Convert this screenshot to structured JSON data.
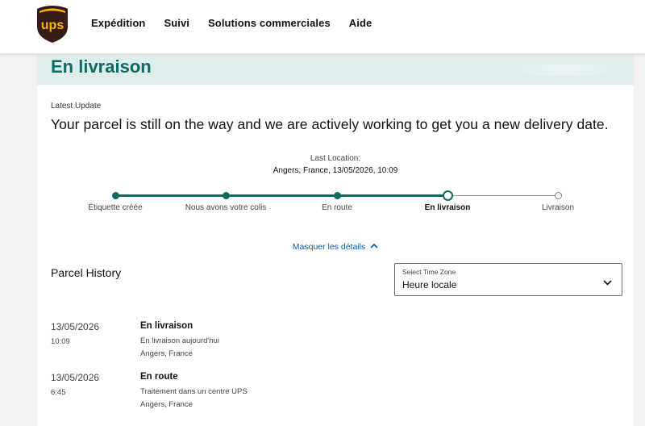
{
  "header": {
    "logo_text": "ups",
    "nav": [
      "Expédition",
      "Suivi",
      "Solutions commerciales",
      "Aide"
    ]
  },
  "status": {
    "title": "En livraison"
  },
  "latest_update": {
    "label": "Latest Update",
    "message": "Your parcel is still on the way and we are actively working to get you a new delivery date."
  },
  "last_location": {
    "label": "Last Location:",
    "value": "Angers, France, 13/05/2026, 10:09"
  },
  "progress": {
    "steps": [
      {
        "label": "Étiquette créée",
        "state": "done"
      },
      {
        "label": "Nous avons votre colis",
        "state": "done"
      },
      {
        "label": "En route",
        "state": "done"
      },
      {
        "label": "En livraison",
        "state": "current"
      },
      {
        "label": "Livraison",
        "state": "future"
      }
    ]
  },
  "details_toggle": "Masquer les détails",
  "history": {
    "title": "Parcel History",
    "timezone": {
      "label": "Select Time Zone",
      "value": "Heure locale"
    },
    "events": [
      {
        "date": "13/05/2026",
        "time": "10:09",
        "status": "En livraison",
        "description": "En livraison aujourd'hui",
        "location": "Angers, France"
      },
      {
        "date": "13/05/2026",
        "time": "6:45",
        "status": "En route",
        "description": "Traitement dans un centre UPS",
        "location": "Angers, France"
      }
    ]
  },
  "colors": {
    "brand_brown": "#351c15",
    "brand_gold": "#ffb500",
    "teal": "#0a6b63",
    "link_blue": "#0b5ea8",
    "status_bg": "#dfeeed"
  },
  "icons": [
    "ups-shield-logo-icon",
    "chevron-up-icon",
    "chevron-down-icon"
  ]
}
